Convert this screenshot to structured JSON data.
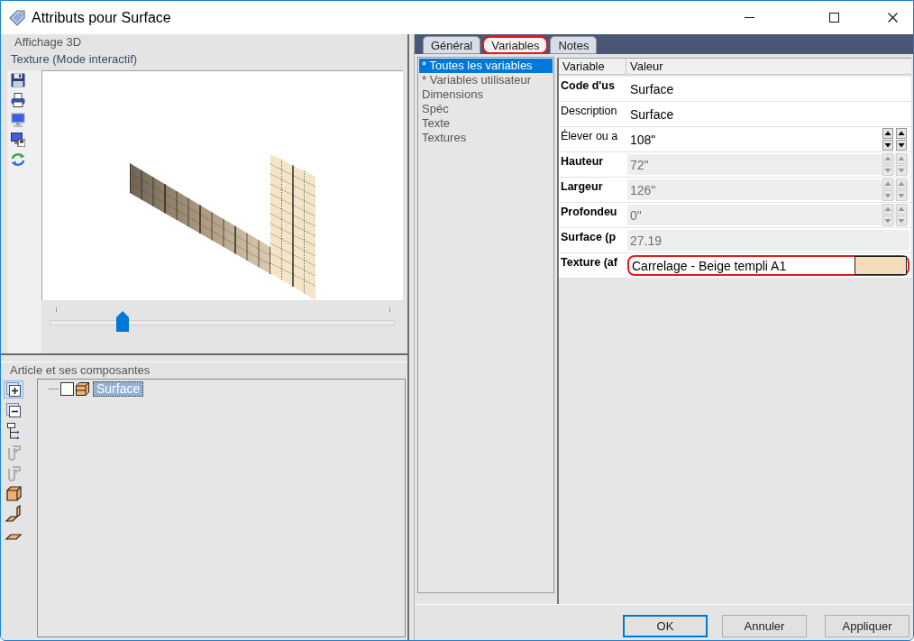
{
  "window": {
    "title": "Attributs pour Surface"
  },
  "viewer": {
    "group_title": "Affichage 3D",
    "mode_label": "Texture (Mode interactif)",
    "slider": {
      "level": 0.21
    }
  },
  "tree_panel": {
    "title": "Article et ses composantes",
    "toolbar": [
      {
        "kind": "plus-square",
        "selected": true,
        "disabled": false
      },
      {
        "kind": "minus-square",
        "selected": false,
        "disabled": false
      },
      {
        "kind": "tree",
        "selected": false,
        "disabled": false
      },
      {
        "kind": "clamp",
        "selected": false,
        "disabled": true
      },
      {
        "kind": "clamp",
        "selected": false,
        "disabled": true
      },
      {
        "kind": "cube",
        "selected": false,
        "disabled": false
      },
      {
        "kind": "corner",
        "selected": false,
        "disabled": false
      },
      {
        "kind": "plate",
        "selected": false,
        "disabled": false
      }
    ],
    "items": [
      {
        "label": "Surface",
        "checked": false,
        "selected": true
      }
    ]
  },
  "tabs": [
    {
      "label": "Général",
      "selected": false,
      "highlighted": false
    },
    {
      "label": "Variables",
      "selected": true,
      "highlighted": true
    },
    {
      "label": "Notes",
      "selected": false,
      "highlighted": false
    }
  ],
  "categories": [
    {
      "label": "* Toutes les variables",
      "selected": true
    },
    {
      "label": "* Variables utilisateur",
      "selected": false
    },
    {
      "label": "Dimensions",
      "selected": false
    },
    {
      "label": "Spéc",
      "selected": false
    },
    {
      "label": "Texte",
      "selected": false
    },
    {
      "label": "Textures",
      "selected": false
    }
  ],
  "grid": {
    "columns": [
      "Variable",
      "Valeur"
    ],
    "rows": [
      {
        "name": "Code d'us",
        "emphasized": true,
        "kind": "text",
        "value": "Surface",
        "disabled": false,
        "highlighted": false
      },
      {
        "name": "Description",
        "emphasized": false,
        "kind": "text",
        "value": "Surface",
        "disabled": false,
        "highlighted": false
      },
      {
        "name": "Élever ou a",
        "emphasized": false,
        "kind": "spin",
        "value": "108\"",
        "disabled": false,
        "highlighted": false
      },
      {
        "name": "Hauteur",
        "emphasized": true,
        "kind": "spin",
        "value": "72\"",
        "disabled": true,
        "highlighted": false
      },
      {
        "name": "Largeur",
        "emphasized": true,
        "kind": "spin",
        "value": "126\"",
        "disabled": true,
        "highlighted": false
      },
      {
        "name": "Profondeu",
        "emphasized": true,
        "kind": "spin",
        "value": "0\"",
        "disabled": true,
        "highlighted": false
      },
      {
        "name": "Surface (p",
        "emphasized": true,
        "kind": "text",
        "value": "27.19",
        "disabled": true,
        "highlighted": false
      },
      {
        "name": "Texture (af",
        "emphasized": true,
        "kind": "texture",
        "value": "Carrelage - Beige templi A1",
        "disabled": false,
        "highlighted": true,
        "color": "#f5dcbb"
      }
    ]
  },
  "buttons": [
    {
      "label": "OK",
      "default": true
    },
    {
      "label": "Annuler",
      "default": false
    },
    {
      "label": "Appliquer",
      "default": false
    }
  ]
}
